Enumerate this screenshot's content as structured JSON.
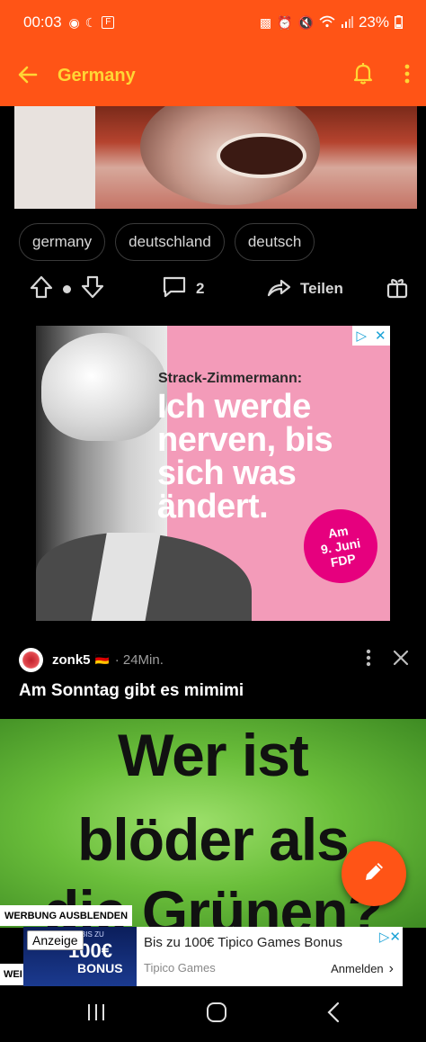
{
  "status_bar": {
    "time": "00:03",
    "battery": "23%",
    "icons": [
      "snapchat-icon",
      "moon-icon",
      "flipboard-icon",
      "sim-icon",
      "alarm-icon",
      "mute-icon",
      "wifi-icon",
      "signal-icon",
      "battery-icon"
    ]
  },
  "app_bar": {
    "title": "Germany",
    "accent_color": "#ff5416",
    "title_color": "#ffd635"
  },
  "post1": {
    "tags": [
      "germany",
      "deutschland",
      "deutsch"
    ],
    "comments_count": "2",
    "share_label": "Teilen"
  },
  "display_ad": {
    "small_headline": "Strack-Zimmermann:",
    "headline": "Ich werde nerven, bis sich was ändert.",
    "badge_line1": "Am",
    "badge_line2": "9. Juni",
    "badge_line3": "FDP"
  },
  "post2": {
    "username": "zonk5",
    "flag": "🇩🇪",
    "timestamp": "· 24Min.",
    "title": "Am Sonntag gibt es mimimi",
    "image_text_line1": "Wer ist",
    "image_text_line2": "blöder als",
    "image_text_line3": "die Grünen?"
  },
  "banner_ad": {
    "hide_label": "WERBUNG AUSBLENDEN",
    "anzeige": "Anzeige",
    "image_amount": "100€",
    "image_bonus": "BONUS",
    "image_small": "BIS ZU",
    "headline": "Bis zu 100€ Tipico Games Bonus",
    "advertiser": "Tipico Games",
    "cta": "Anmelden",
    "left_strip": "WEI"
  }
}
